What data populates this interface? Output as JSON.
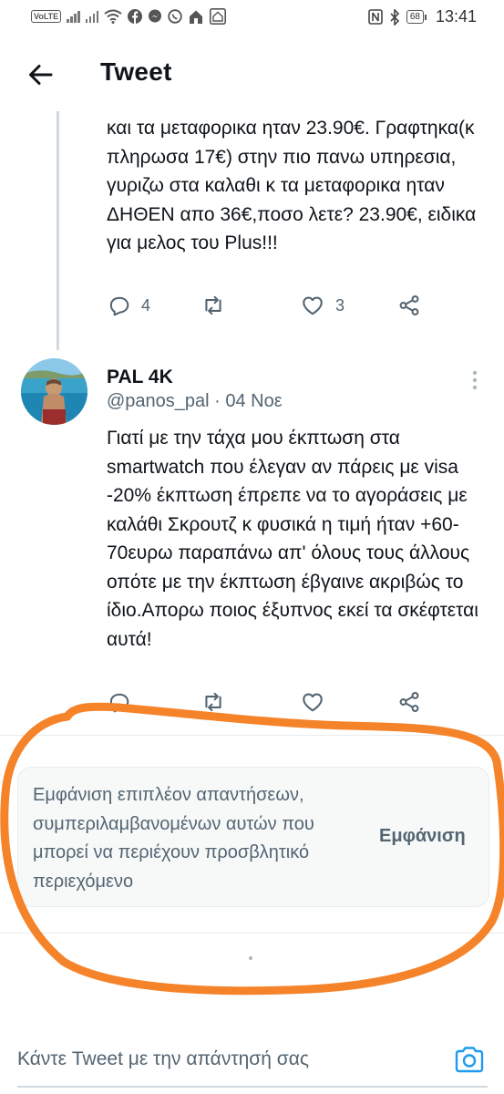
{
  "status_bar": {
    "time": "13:41",
    "battery": "68",
    "volte": "VoLTE",
    "icons": [
      "volte-icon",
      "signal-icon",
      "signal-icon",
      "wifi-icon",
      "facebook-icon",
      "messenger-icon",
      "viber-icon",
      "home-icon",
      "home-icon",
      "nfc-icon",
      "bluetooth-icon",
      "battery-icon"
    ]
  },
  "header": {
    "title": "Tweet",
    "back_icon": "arrow-left-icon"
  },
  "tweet1": {
    "text": "και τα μεταφορικα ηταν 23.90€. Γραφτηκα(κ πληρωσα 17€) στην πιο πανω υπηρεσια, γυριζω στα καλαθι κ τα μεταφορικα ηταν ΔΗΘΕΝ απο 36€,ποσο λετε? 23.90€, ειδικα για μελος του Plus!!!",
    "replies": "4",
    "likes": "3"
  },
  "tweet2": {
    "name": "PAL 4K",
    "handle": "@panos_pal · 04 Νοε",
    "text": "Γιατί με την τάχα μου έκπτωση στα smartwatch που έλεγαν αν πάρεις με visa -20% έκπτωση έπρεπε να το αγοράσεις με καλάθι Σκρουτζ κ φυσικά η τιμή ήταν +60-70ευρω παραπάνω απ' όλους τους άλλους οπότε με την έκπτωση έβγαινε ακριβώς το ίδιο.Απορω ποιος έξυπνος εκεί τα σκέφτεται αυτά!"
  },
  "more_replies": {
    "text": "Εμφάνιση επιπλέον απαντήσεων, συμπεριλαμβανομένων αυτών που μπορεί να περιέχουν προσβλητικό περιεχόμενο",
    "button": "Εμφάνιση"
  },
  "reply_bar": {
    "placeholder": "Κάντε Tweet με την απάντησή σας"
  },
  "colors": {
    "text": "#0f1419",
    "secondary": "#536471",
    "accent": "#1d9bf0",
    "annotation": "#f5832a"
  }
}
